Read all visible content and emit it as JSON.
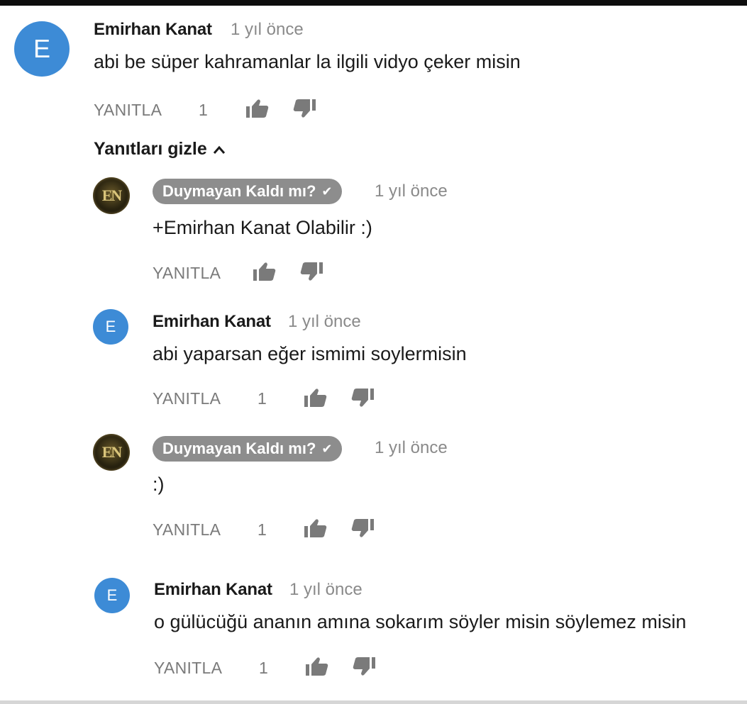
{
  "comments": [
    {
      "author": "Emirhan Kanat",
      "time": "1 yıl önce",
      "text": "abi be süper kahramanlar la ilgili vidyo çeker misin",
      "reply_label": "YANITLA",
      "likes": "1",
      "avatar_letter": "E"
    },
    {
      "author": "Duymayan Kaldı mı?",
      "time": "1 yıl önce",
      "text": "+Emirhan Kanat Olabilir :)",
      "reply_label": "YANITLA",
      "likes": "",
      "avatar_letter": "EN",
      "verified": true
    },
    {
      "author": "Emirhan Kanat",
      "time": "1 yıl önce",
      "text": "abi yaparsan eğer ismimi soylermisin",
      "reply_label": "YANITLA",
      "likes": "1",
      "avatar_letter": "E"
    },
    {
      "author": "Duymayan Kaldı mı?",
      "time": "1 yıl önce",
      "text": ":)",
      "reply_label": "YANITLA",
      "likes": "1",
      "avatar_letter": "EN",
      "verified": true
    },
    {
      "author": "Emirhan Kanat",
      "time": "1 yıl önce",
      "text": "o gülücüğü ananın amına sokarım söyler misin söylemez misin",
      "reply_label": "YANITLA",
      "likes": "1",
      "avatar_letter": "E"
    }
  ],
  "replies_toggle": {
    "label": "Yanıtları gizle",
    "icon": "chevron-up-icon"
  },
  "colors": {
    "avatar_blue": "#3d8bd6",
    "chip_gray": "#8d8d8d",
    "meta_gray": "#8a8a8a"
  }
}
